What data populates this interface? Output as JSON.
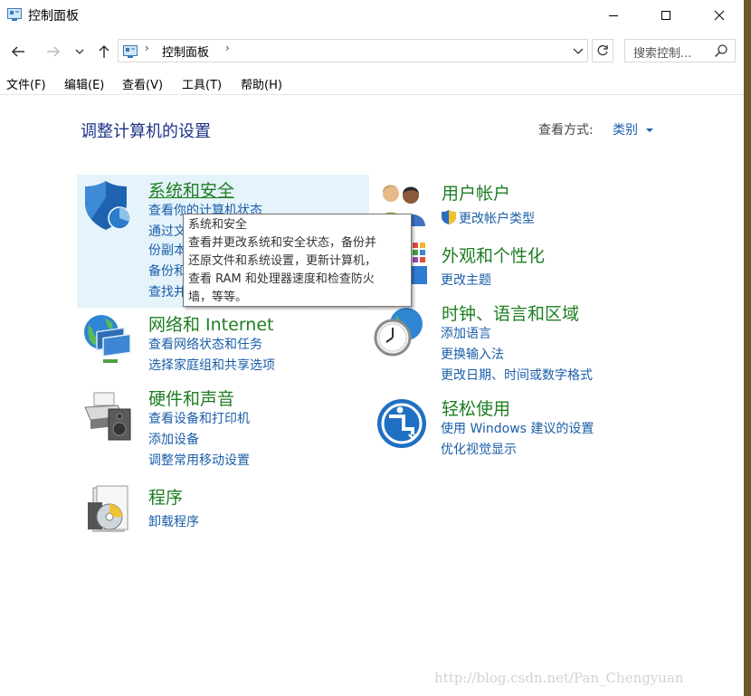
{
  "window": {
    "title": "控制面板"
  },
  "address": {
    "path": "控制面板",
    "search_placeholder": "搜索控制..."
  },
  "menu": [
    "文件(F)",
    "编辑(E)",
    "查看(V)",
    "工具(T)",
    "帮助(H)"
  ],
  "header": {
    "title": "调整计算机的设置",
    "view_by_label": "查看方式:",
    "view_by_value": "类别"
  },
  "categories": {
    "system_security": {
      "title": "系统和安全",
      "links": [
        "查看你的计算机状态",
        "通过文",
        "份副本",
        "备份和",
        "查找并"
      ]
    },
    "network": {
      "title": "网络和 Internet",
      "links": [
        "查看网络状态和任务",
        "选择家庭组和共享选项"
      ]
    },
    "hardware": {
      "title": "硬件和声音",
      "links": [
        "查看设备和打印机",
        "添加设备",
        "调整常用移动设置"
      ]
    },
    "programs": {
      "title": "程序",
      "links": [
        "卸载程序"
      ]
    },
    "user_accounts": {
      "title": "用户帐户",
      "links": [
        "更改帐户类型"
      ]
    },
    "appearance": {
      "title": "外观和个性化",
      "links": [
        "更改主题"
      ]
    },
    "clock_region": {
      "title": "时钟、语言和区域",
      "links": [
        "添加语言",
        "更换输入法",
        "更改日期、时间或数字格式"
      ]
    },
    "ease_access": {
      "title": "轻松使用",
      "links": [
        "使用 Windows 建议的设置",
        "优化视觉显示"
      ]
    }
  },
  "tooltip": {
    "lines": [
      "系统和安全",
      "查看并更改系统和安全状态，备份并",
      "还原文件和系统设置，更新计算机，",
      "查看 RAM 和处理器速度和检查防火",
      "墙，等等。"
    ]
  },
  "watermark": "http://blog.csdn.net/Pan_Chengyuan",
  "colors": {
    "title_blue": "#1e3287",
    "category_green": "#1e7e22",
    "link_blue": "#1a5ea8",
    "hover_bg": "#e5f3fb"
  }
}
